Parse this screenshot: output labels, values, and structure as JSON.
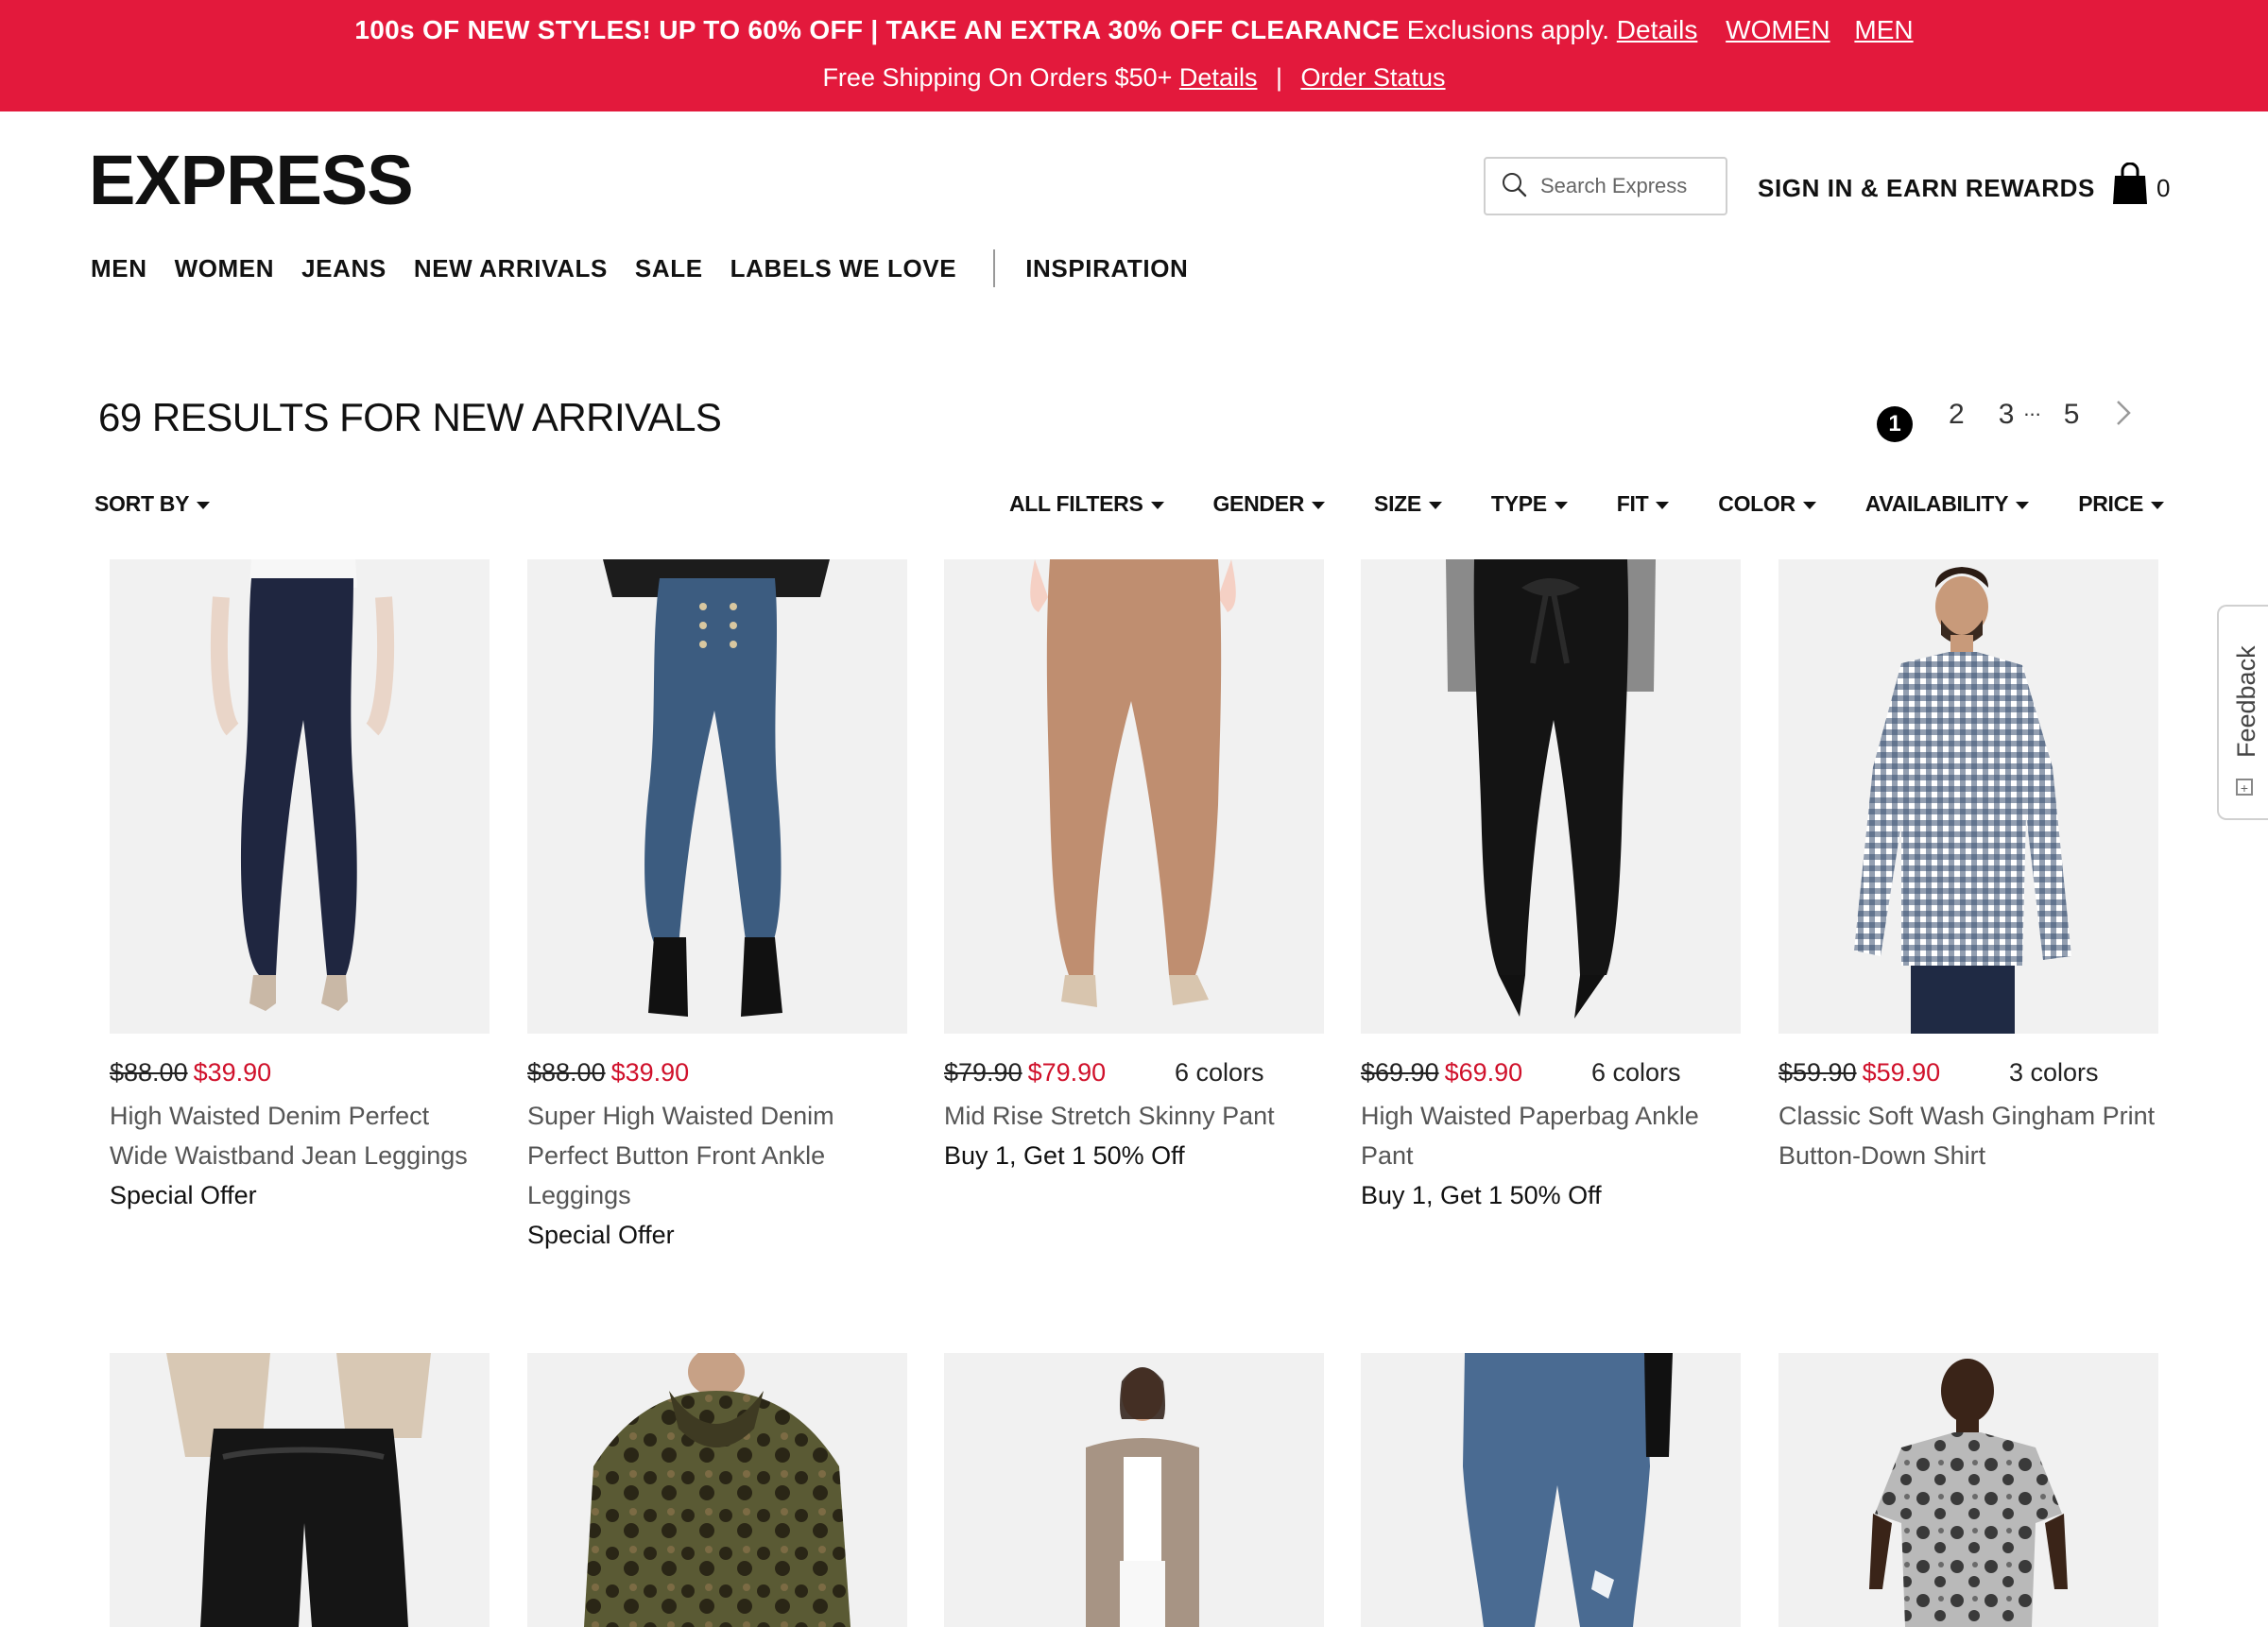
{
  "promo": {
    "headline": "100s OF NEW STYLES! UP TO 60% OFF | TAKE AN EXTRA 30% OFF CLEARANCE",
    "exclusions": "Exclusions apply.",
    "details_link": "Details",
    "women_link": "WOMEN",
    "men_link": "MEN",
    "shipping": "Free Shipping On Orders $50+",
    "shipping_details_link": "Details",
    "separator": "|",
    "order_status_link": "Order Status"
  },
  "header": {
    "logo": "EXPRESS",
    "search_placeholder": "Search Express",
    "signin_label": "SIGN IN & EARN REWARDS",
    "bag_count": "0"
  },
  "nav": {
    "items": [
      "MEN",
      "WOMEN",
      "JEANS",
      "NEW ARRIVALS",
      "SALE",
      "LABELS WE LOVE"
    ],
    "inspiration": "INSPIRATION"
  },
  "results": {
    "title": "69 RESULTS FOR NEW ARRIVALS"
  },
  "pagination": {
    "current": "1",
    "pages": [
      "2",
      "3"
    ],
    "ellipsis": "...",
    "last": "5"
  },
  "filters": {
    "sort_by": "SORT BY",
    "items": [
      "ALL FILTERS",
      "GENDER",
      "SIZE",
      "TYPE",
      "FIT",
      "COLOR",
      "AVAILABILITY",
      "PRICE"
    ]
  },
  "products": [
    {
      "old_price": "$88.00",
      "new_price": "$39.90",
      "colors": "",
      "name": "High Waisted Denim Perfect Wide Waistband Jean Leggings",
      "offer": "Special Offer"
    },
    {
      "old_price": "$88.00",
      "new_price": "$39.90",
      "colors": "",
      "name": "Super High Waisted Denim Perfect Button Front Ankle Leggings",
      "offer": "Special Offer"
    },
    {
      "old_price": "$79.90",
      "new_price": "$79.90",
      "colors": "6 colors",
      "name": "Mid Rise Stretch Skinny Pant",
      "offer": "Buy 1, Get 1 50% Off"
    },
    {
      "old_price": "$69.90",
      "new_price": "$69.90",
      "colors": "6 colors",
      "name": "High Waisted Paperbag Ankle Pant",
      "offer": "Buy 1, Get 1 50% Off"
    },
    {
      "old_price": "$59.90",
      "new_price": "$59.90",
      "colors": "3 colors",
      "name": "Classic Soft Wash Gingham Print Button-Down Shirt",
      "offer": ""
    }
  ],
  "feedback": {
    "label": "Feedback",
    "icon_glyph": "+"
  },
  "colors": {
    "banner_red": "#e3193c",
    "sale_red": "#d0112b",
    "image_bg": "#f1f1f1"
  }
}
